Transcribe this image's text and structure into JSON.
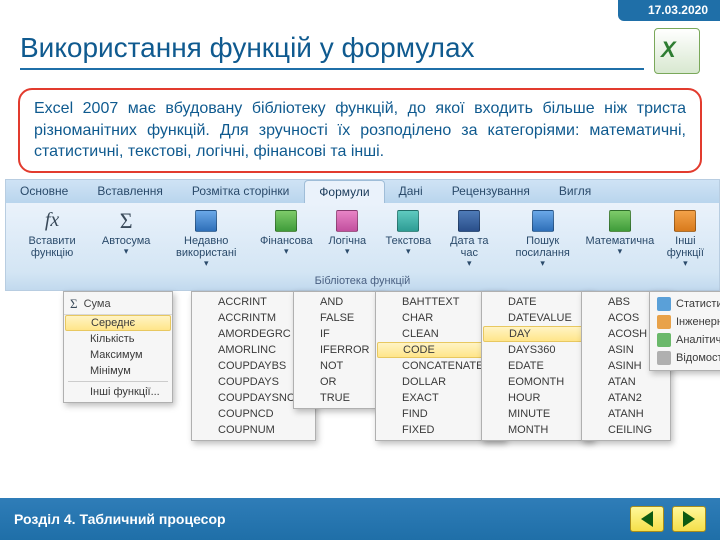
{
  "date": "17.03.2020",
  "title": "Використання функцій у формулах",
  "info": "Excel 2007 має вбудовану бібліотеку функцій, до якої входить більше ніж триста різноманітних функцій. Для зручності їх розподілено за категоріями: математичні, статистичні, текстові, логічні, фінансові та інші.",
  "ribbon": {
    "tabs": [
      "Основне",
      "Вставлення",
      "Розмітка сторінки",
      "Формули",
      "Дані",
      "Рецензування",
      "Вигля"
    ],
    "active_tab": "Формули",
    "buttons": {
      "insert_fn": "Вставити функцію",
      "autosum": "Автосума",
      "recent": "Недавно використані",
      "financial": "Фінансова",
      "logical": "Логічна",
      "text": "Текстова",
      "datetime": "Дата та час",
      "lookup": "Пошук посилання",
      "math": "Математична",
      "more": "Інші функції"
    },
    "group_label": "Бібліотека функцій"
  },
  "menus": {
    "autosum": {
      "header": "Сума",
      "items": [
        "Середнє",
        "Кількість",
        "Максимум",
        "Мінімум"
      ],
      "footer": "Інші функції...",
      "highlight": "Середнє"
    },
    "financial": [
      "ACCRINT",
      "ACCRINTM",
      "AMORDEGRC",
      "AMORLINC",
      "COUPDAYBS",
      "COUPDAYS",
      "COUPDAYSNC",
      "COUPNCD",
      "COUPNUM"
    ],
    "logical": [
      "AND",
      "FALSE",
      "IF",
      "IFERROR",
      "NOT",
      "OR",
      "TRUE"
    ],
    "text": [
      "BAHTTEXT",
      "CHAR",
      "CLEAN",
      "CODE",
      "CONCATENATE",
      "DOLLAR",
      "EXACT",
      "FIND",
      "FIXED"
    ],
    "text_highlight": "CODE",
    "datetime": [
      "DATE",
      "DATEVALUE",
      "DAY",
      "DAYS360",
      "EDATE",
      "EOMONTH",
      "HOUR",
      "MINUTE",
      "MONTH"
    ],
    "datetime_highlight": "DAY",
    "math": [
      "ABS",
      "ACOS",
      "ACOSH",
      "ASIN",
      "ASINH",
      "ATAN",
      "ATAN2",
      "ATANH",
      "CEILING"
    ],
    "more": [
      "Статистична",
      "Інженерні",
      "Аналітичні",
      "Відомості"
    ]
  },
  "footer": "Розділ 4. Табличний процесор"
}
